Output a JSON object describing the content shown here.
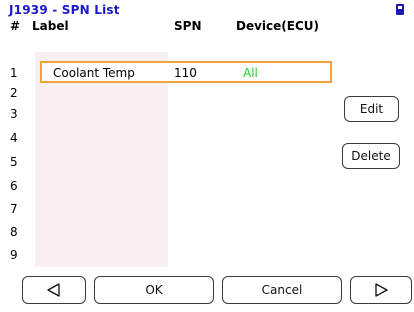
{
  "header": {
    "title": "J1939 - SPN List",
    "status_icon": "battery-icon"
  },
  "columns": {
    "num": "#",
    "label": "Label",
    "spn": "SPN",
    "device": "Device(ECU)"
  },
  "rows": [
    {
      "num": "1",
      "label": "Coolant Temp",
      "spn": "110",
      "device": "All"
    },
    {
      "num": "2"
    },
    {
      "num": "3"
    },
    {
      "num": "4"
    },
    {
      "num": "5"
    },
    {
      "num": "6"
    },
    {
      "num": "7"
    },
    {
      "num": "8"
    },
    {
      "num": "9"
    }
  ],
  "selected_row": 1,
  "side_buttons": {
    "edit": "Edit",
    "delete": "Delete"
  },
  "footer": {
    "prev_icon": "triangle-left-icon",
    "ok": "OK",
    "cancel": "Cancel",
    "next_icon": "triangle-right-icon"
  },
  "colors": {
    "title": "#1a1ac8",
    "selection_border": "#f0a43a",
    "device_text": "#2ad12a",
    "label_column_bg": "#f7eff1"
  }
}
